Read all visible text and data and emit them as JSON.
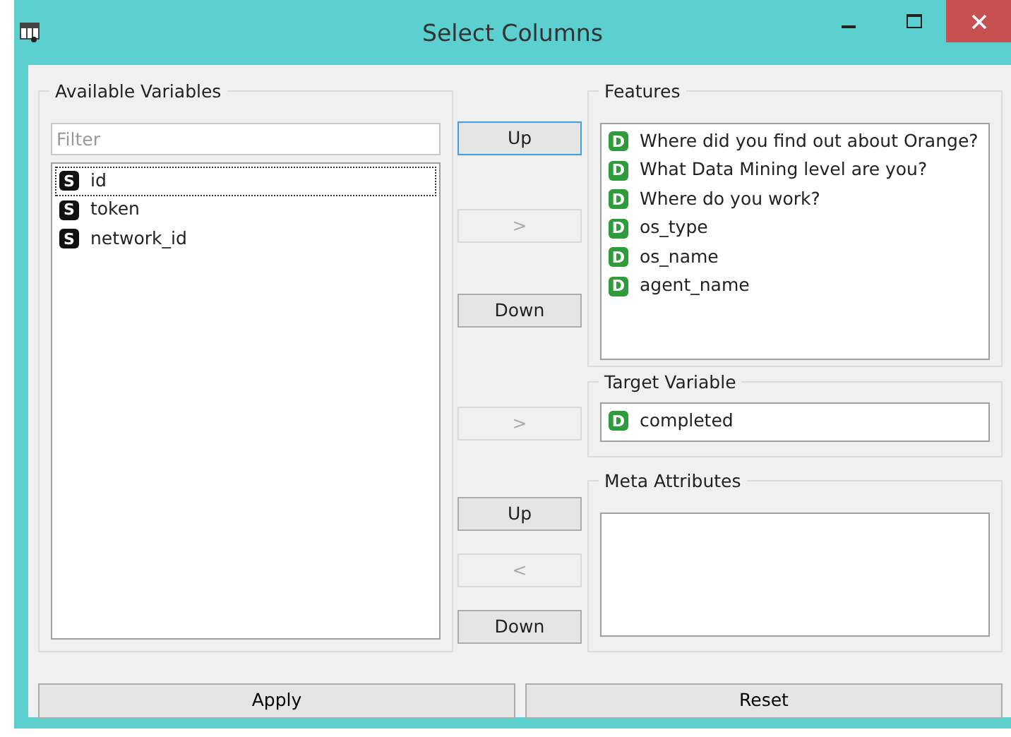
{
  "window": {
    "title": "Select Columns"
  },
  "available": {
    "title": "Available Variables",
    "filter_placeholder": "Filter",
    "items": [
      {
        "label": "id",
        "badge": "S",
        "kind": "string",
        "focused": true
      },
      {
        "label": "token",
        "badge": "S",
        "kind": "string",
        "focused": false
      },
      {
        "label": "network_id",
        "badge": "S",
        "kind": "string",
        "focused": false
      }
    ]
  },
  "middle_buttons": [
    [
      {
        "label": "Up",
        "disabled": false,
        "focused": true
      },
      {
        "label": ">",
        "disabled": true,
        "focused": false
      },
      {
        "label": "Down",
        "disabled": false,
        "focused": false
      }
    ],
    [
      {
        "label": ">",
        "disabled": true,
        "focused": false
      }
    ],
    [
      {
        "label": "Up",
        "disabled": false,
        "focused": false
      },
      {
        "label": "<",
        "disabled": true,
        "focused": false
      },
      {
        "label": "Down",
        "disabled": false,
        "focused": false
      }
    ]
  ],
  "features": {
    "title": "Features",
    "items": [
      {
        "label": "Where did you find out about Orange?",
        "badge": "D",
        "kind": "discrete"
      },
      {
        "label": "What Data Mining level are you?",
        "badge": "D",
        "kind": "discrete"
      },
      {
        "label": "Where do you work?",
        "badge": "D",
        "kind": "discrete"
      },
      {
        "label": "os_type",
        "badge": "D",
        "kind": "discrete"
      },
      {
        "label": "os_name",
        "badge": "D",
        "kind": "discrete"
      },
      {
        "label": "agent_name",
        "badge": "D",
        "kind": "discrete"
      }
    ]
  },
  "target": {
    "title": "Target Variable",
    "items": [
      {
        "label": "completed",
        "badge": "D",
        "kind": "discrete"
      }
    ]
  },
  "meta": {
    "title": "Meta Attributes"
  },
  "bottom_buttons": [
    "Apply",
    "Reset"
  ]
}
